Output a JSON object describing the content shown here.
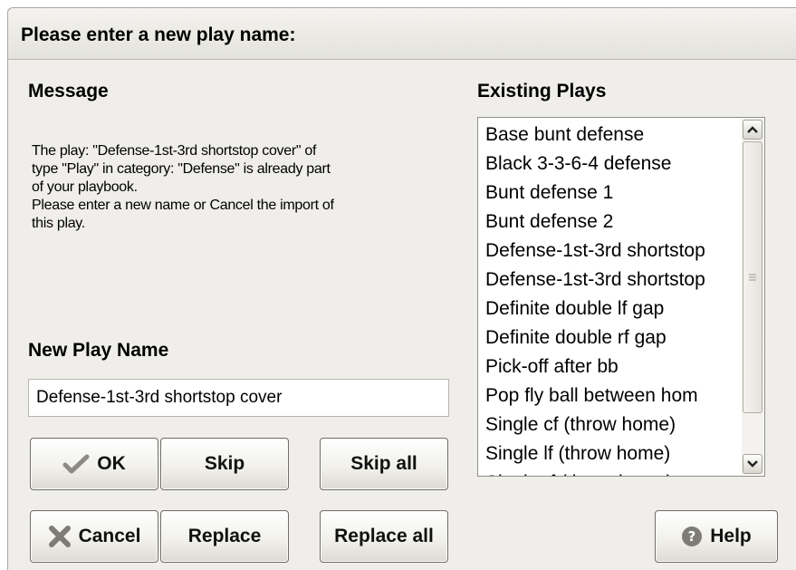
{
  "dialog": {
    "title": "Please enter a new play name:"
  },
  "message": {
    "heading": "Message",
    "text": "The play: \"Defense-1st-3rd shortstop cover\" of\ntype \"Play\" in category: \"Defense\" is already part\nof your playbook.\nPlease enter a new name or Cancel the import of\nthis play."
  },
  "new_name": {
    "heading": "New Play Name",
    "value": "Defense-1st-3rd shortstop cover"
  },
  "existing": {
    "heading": "Existing Plays",
    "items": [
      "Base bunt defense",
      "Black 3-3-6-4 defense",
      "Bunt defense 1",
      "Bunt defense 2",
      "Defense-1st-3rd shortstop",
      "Defense-1st-3rd shortstop",
      "Definite double lf gap",
      "Definite double rf gap",
      "Pick-off after bb",
      "Pop fly ball between hom",
      "Single cf (throw home)",
      "Single lf (throw home)",
      "Single rf (throw home)"
    ]
  },
  "buttons": {
    "ok": "OK",
    "skip": "Skip",
    "skip_all": "Skip all",
    "cancel": "Cancel",
    "replace": "Replace",
    "replace_all": "Replace all",
    "help": "Help"
  },
  "icons": {
    "ok": "check-icon",
    "cancel": "x-icon",
    "help": "question-icon",
    "scroll_up": "chevron-up-icon",
    "scroll_down": "chevron-down-icon"
  }
}
